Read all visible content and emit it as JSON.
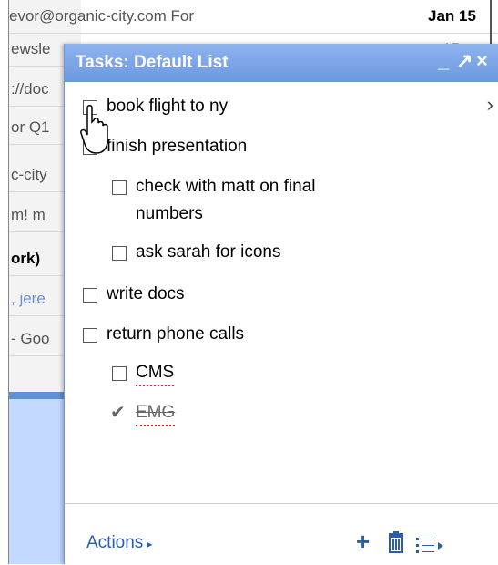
{
  "background": {
    "rows": [
      {
        "left": "ewsle",
        "right": "-- 15"
      },
      {
        "left": "://doc",
        "right": ""
      },
      {
        "left": "or Q1",
        "right": ""
      },
      {
        "left": "c-city",
        "right": ""
      },
      {
        "left": "m! m",
        "right": ""
      },
      {
        "left": "ork)",
        "right": ""
      },
      {
        "left": ", jere",
        "right": ""
      },
      {
        "left": "- Goo",
        "right": ""
      }
    ],
    "top_text": "evor@organic-city.com  For",
    "top_right": "Jan 15"
  },
  "panel": {
    "title": "Tasks: Default List",
    "minimize": "_",
    "popout": "↗",
    "close": "×"
  },
  "tasks": [
    {
      "label": "book flight to ny",
      "indent": 0,
      "checked": false
    },
    {
      "label": "finish presentation",
      "indent": 0,
      "checked": false
    },
    {
      "label": "check with matt on final",
      "label2": "numbers",
      "indent": 1,
      "checked": false
    },
    {
      "label": "ask sarah for icons",
      "indent": 1,
      "checked": false
    },
    {
      "label": "write docs",
      "indent": 0,
      "checked": false
    },
    {
      "label": "return phone calls",
      "indent": 0,
      "checked": false
    },
    {
      "label": "CMS",
      "indent": 1,
      "checked": false
    },
    {
      "label": "EMG",
      "indent": 1,
      "checked": true
    }
  ],
  "footer": {
    "actions_label": "Actions",
    "actions_arrow": "▸",
    "add_icon": "+",
    "delete_icon": "trash-icon",
    "list_icon": "list-menu-icon"
  },
  "colors": {
    "title_bar": "#6b98df",
    "link": "#2a5db0"
  }
}
